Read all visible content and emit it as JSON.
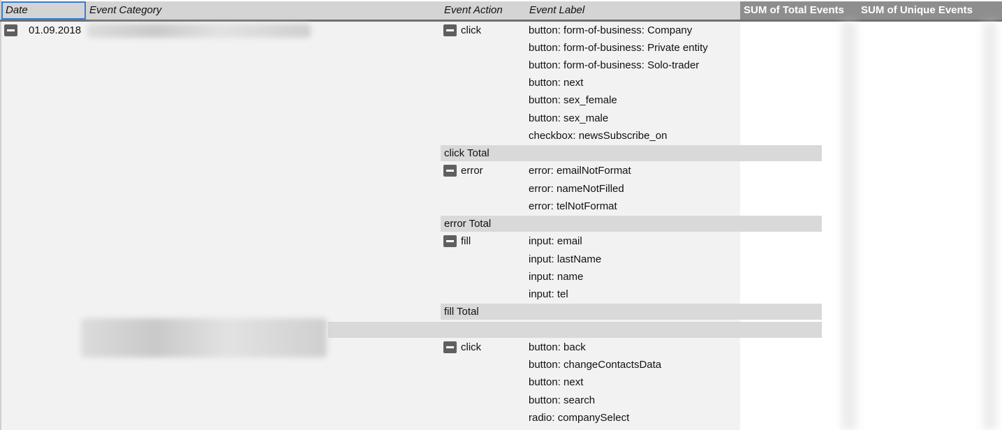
{
  "header": {
    "date": "Date",
    "event_category": "Event Category",
    "event_action": "Event Action",
    "event_label": "Event Label",
    "sum_total_events": "SUM of Total Events",
    "sum_unique_events": "SUM of Unique Events"
  },
  "group1": {
    "date": "01.09.2018",
    "actions": [
      {
        "name": "click",
        "labels": [
          "button: form-of-business: Company",
          "button: form-of-business: Private entity",
          "button: form-of-business: Solo-trader",
          "button: next",
          "button: sex_female",
          "button: sex_male",
          "checkbox: newsSubscribe_on"
        ],
        "total": "click Total"
      },
      {
        "name": "error",
        "labels": [
          "error: emailNotFormat",
          "error: nameNotFilled",
          "error: telNotFormat"
        ],
        "total": "error Total"
      },
      {
        "name": "fill",
        "labels": [
          "input: email",
          "input: lastName",
          "input: name",
          "input: tel"
        ],
        "total": "fill Total"
      }
    ]
  },
  "group2": {
    "actions": [
      {
        "name": "click",
        "labels": [
          "button: back",
          "button: changeContactsData",
          "button: next",
          "button: search",
          "radio: companySelect"
        ]
      }
    ]
  }
}
